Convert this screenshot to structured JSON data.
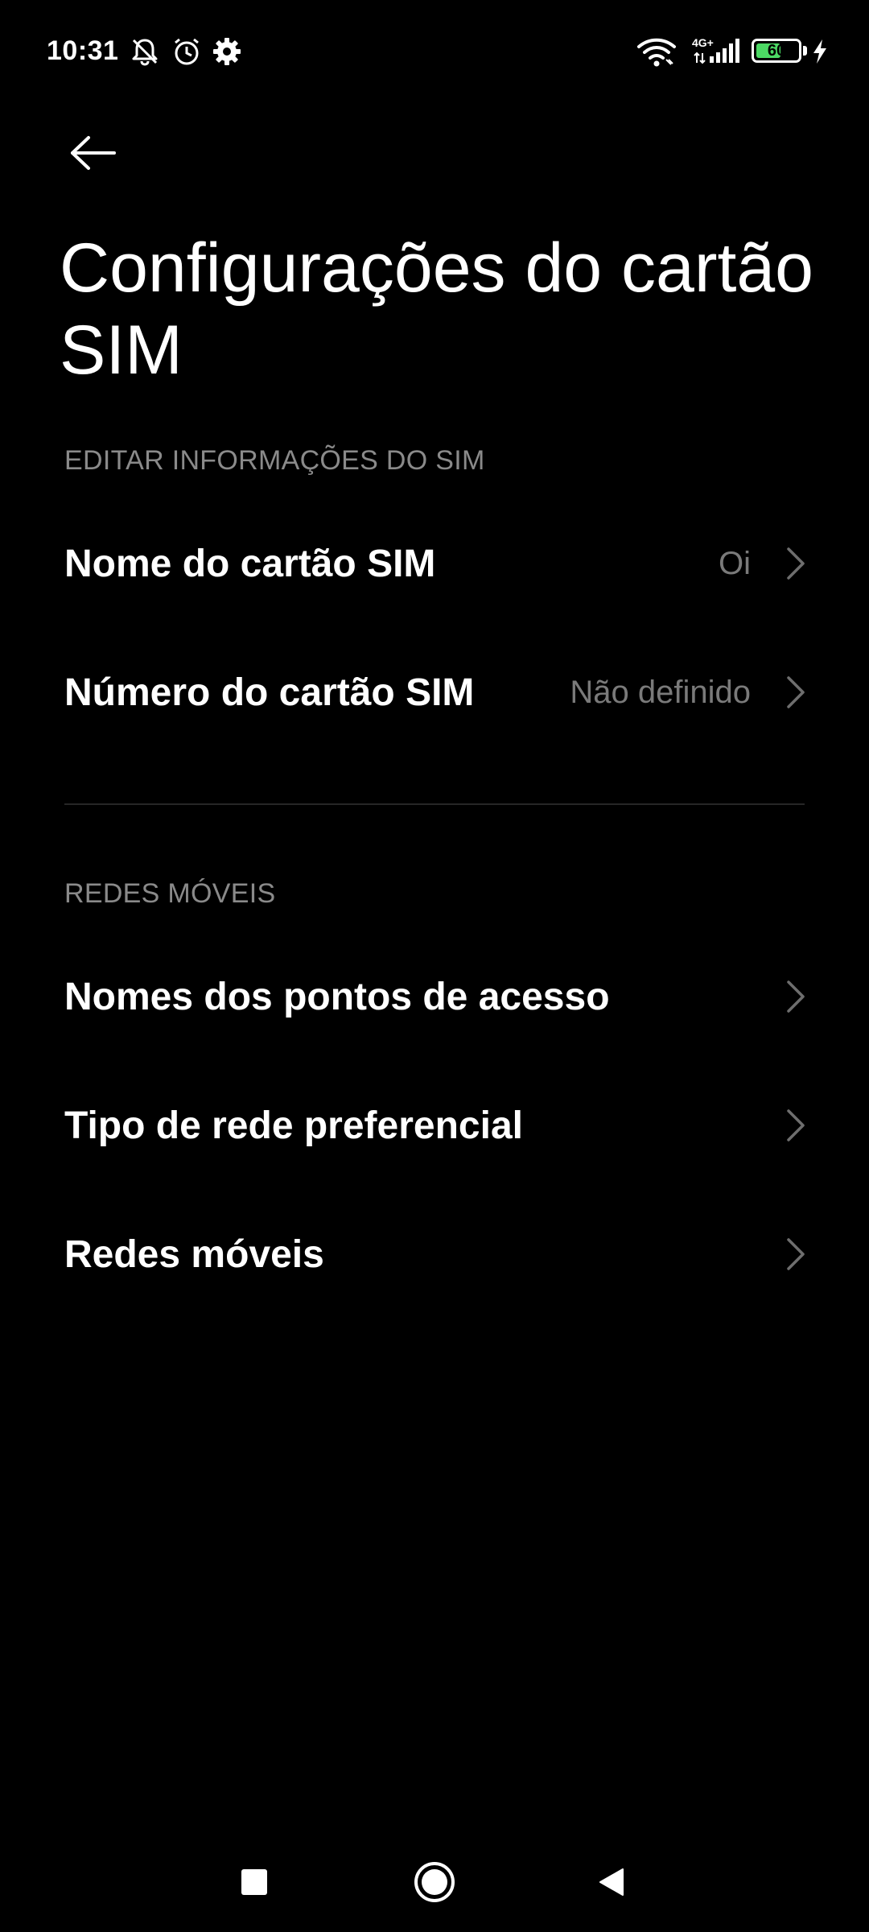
{
  "status_bar": {
    "time": "10:31",
    "network_type": "4G+",
    "battery_level": "60",
    "battery_fraction": 0.6,
    "battery_color": "#4cd964",
    "icons": [
      "bell-off-icon",
      "alarm-icon",
      "gear-icon",
      "wifi-icon",
      "signal-icon",
      "battery-icon",
      "charging-icon"
    ]
  },
  "header": {
    "back_icon": "arrow-left-icon",
    "title": "Configurações do cartão SIM"
  },
  "sections": {
    "sim_info": {
      "header": "EDITAR INFORMAÇÕES DO SIM",
      "items": [
        {
          "label": "Nome do cartão SIM",
          "value": "Oi"
        },
        {
          "label": "Número do cartão SIM",
          "value": "Não definido"
        }
      ]
    },
    "mobile_networks": {
      "header": "REDES MÓVEIS",
      "items": [
        {
          "label": "Nomes dos pontos de acesso"
        },
        {
          "label": "Tipo de rede preferencial"
        },
        {
          "label": "Redes móveis"
        }
      ]
    }
  },
  "nav_bar": {
    "icons": [
      "recents-square-icon",
      "home-circle-icon",
      "back-triangle-icon"
    ]
  }
}
